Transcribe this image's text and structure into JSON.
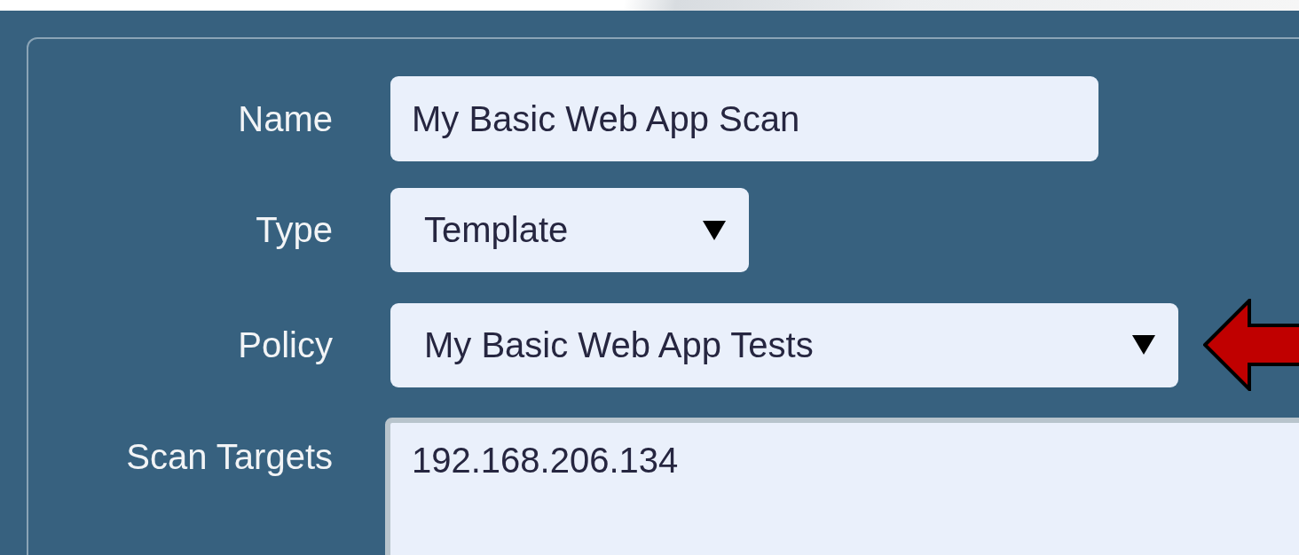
{
  "form": {
    "fields": [
      {
        "kind": "text",
        "label": "Name",
        "value": "My Basic Web App Scan"
      },
      {
        "kind": "select",
        "label": "Type",
        "value": "Template"
      },
      {
        "kind": "select",
        "label": "Policy",
        "value": "My Basic Web App Tests"
      },
      {
        "kind": "textarea",
        "label": "Scan Targets",
        "value": "192.168.206.134"
      }
    ]
  }
}
